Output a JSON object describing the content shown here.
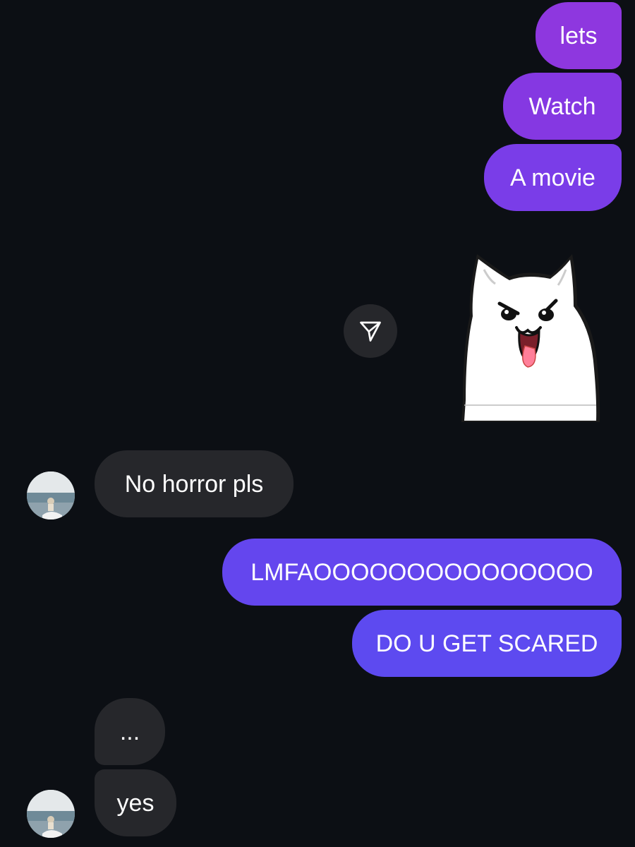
{
  "messages": {
    "sent_1": "lets",
    "sent_2": "Watch",
    "sent_3": "A movie",
    "received_1": "No horror pls",
    "sent_4": "LMFAOOOOOOOOOOOOOOO",
    "sent_5": "DO U GET SCARED",
    "received_2": "...",
    "received_3": "yes"
  },
  "icons": {
    "share": "paper-plane-icon",
    "sticker": "cat-sticker",
    "avatar": "contact-avatar"
  },
  "colors": {
    "background": "#0c0f14",
    "received_bubble": "#26272b",
    "sent_top": "#8e37df",
    "sent_bottom": "#5d4af0",
    "text": "#ffffff"
  }
}
